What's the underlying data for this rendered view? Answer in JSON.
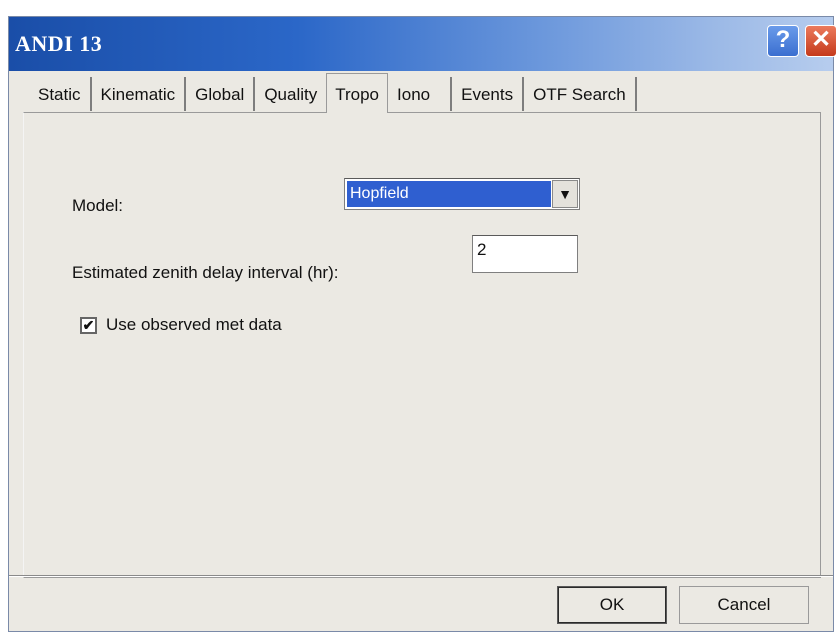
{
  "window": {
    "title": "ANDI 13",
    "help_label": "?",
    "close_label": "✕"
  },
  "tabs": [
    {
      "label": "Static"
    },
    {
      "label": "Kinematic"
    },
    {
      "label": "Global"
    },
    {
      "label": "Quality"
    },
    {
      "label": "Tropo"
    },
    {
      "label": "Iono"
    },
    {
      "label": "Events"
    },
    {
      "label": "OTF Search"
    }
  ],
  "active_tab": "Tropo",
  "form": {
    "model_label": "Model:",
    "model_value": "Hopfield",
    "model_arrow": "▼",
    "zenith_label": "Estimated zenith delay interval (hr):",
    "zenith_value": "2",
    "met_checkbox_checked": true,
    "met_checkbox_mark": "✔",
    "met_label": "Use observed met data"
  },
  "buttons": {
    "ok_label": "OK",
    "cancel_label": "Cancel"
  },
  "colors": {
    "title_gradient_start": "#1a4ea8",
    "selection": "#2f5fd0",
    "dialog_bg": "#ebe9e3",
    "close_button": "#c53a1c"
  },
  "icons": {
    "help": "help-icon",
    "close": "close-icon",
    "dropdown": "chevron-down-icon",
    "check": "check-icon"
  }
}
